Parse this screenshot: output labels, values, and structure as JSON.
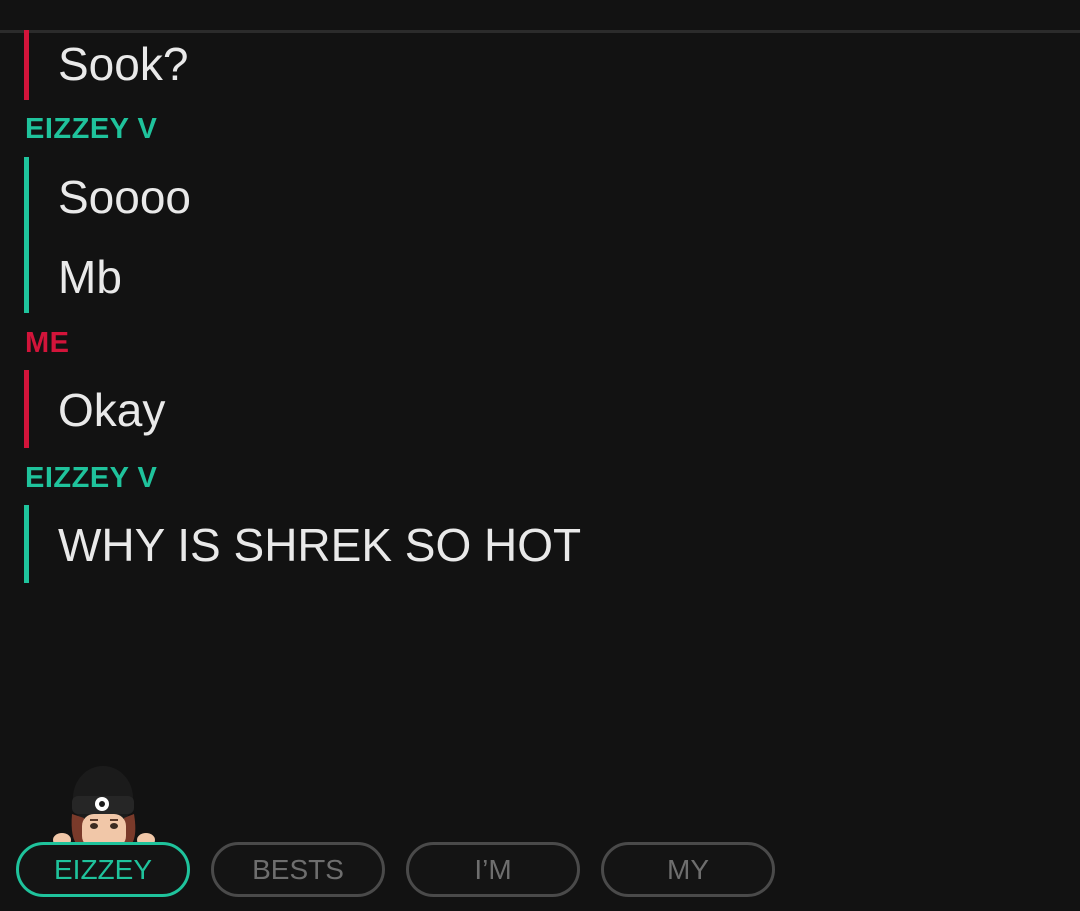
{
  "conversation": [
    {
      "sender": "",
      "side": "me",
      "messages": [
        "Sook?"
      ]
    },
    {
      "sender": "EIZZEY V",
      "side": "them",
      "messages": [
        "Soooo",
        "Mb"
      ]
    },
    {
      "sender": "ME",
      "side": "me",
      "messages": [
        "Okay"
      ]
    },
    {
      "sender": "EIZZEY V",
      "side": "them",
      "messages": [
        "WHY IS SHREK SO HOT"
      ]
    }
  ],
  "chips": [
    {
      "label": "EIZZEY",
      "active": true
    },
    {
      "label": "BESTS",
      "active": false
    },
    {
      "label": "I’M",
      "active": false
    },
    {
      "label": "MY",
      "active": false
    }
  ],
  "colors": {
    "background": "#121212",
    "me_accent": "#d2143a",
    "them_accent": "#1fc39c",
    "chip_border": "#4a4a4a",
    "chip_text": "#6e6e6e"
  },
  "icons": {
    "bitmoji": "bitmoji-avatar-icon"
  }
}
